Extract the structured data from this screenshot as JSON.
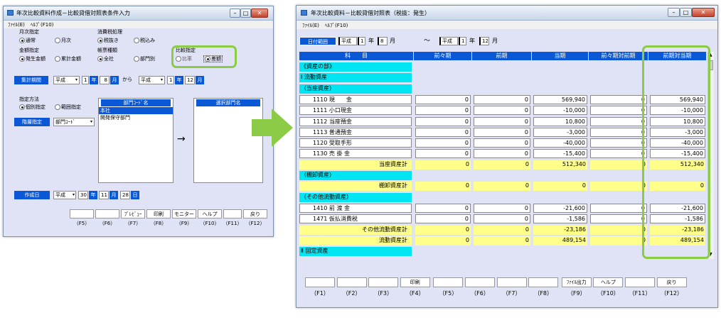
{
  "colors": {
    "accent_blue": "#0a58d6",
    "highlight_cyan": "#00e5f2",
    "subtotal_yellow": "#ffff8a",
    "callout_green": "#8ccb45",
    "panel_bg": "#dfe3f5"
  },
  "left": {
    "title": "年次比較資料作成－比較貸借対照表条件入力",
    "menu": [
      "ﾌｧｲﾙ(E)",
      "ﾍﾙﾌﾟ(F10)"
    ],
    "monthly": {
      "label": "月次指定",
      "options": [
        "通常",
        "月次"
      ]
    },
    "tax": {
      "label": "消費税処理",
      "options": [
        "税抜き",
        "税込み"
      ]
    },
    "amount": {
      "label": "金額指定",
      "options": [
        "発生金額",
        "累計金額"
      ]
    },
    "form": {
      "label": "帳票種類",
      "options": [
        "全社",
        "部門別"
      ]
    },
    "compare": {
      "label": "比較指定",
      "options": [
        "比率",
        "差額"
      ]
    },
    "period": {
      "label": "集計期間",
      "era_from": "平成",
      "year_from": "1",
      "unit_year": "年",
      "month_from": "8",
      "unit_month": "月",
      "kara": "から",
      "era_to": "平成",
      "year_to": "1",
      "month_to": "12"
    },
    "method": {
      "label": "指定方法",
      "options": [
        "個別指定",
        "範囲指定"
      ]
    },
    "hierarchy": {
      "label": "階層指定",
      "value": "部門ｺｰﾄﾞ"
    },
    "dept_list": {
      "header": "部門ｺｰﾄﾞ名",
      "items": [
        "本社",
        "開発保守部門"
      ]
    },
    "arrow": "→",
    "selected_list": {
      "header": "選択部門名"
    },
    "created": {
      "label": "作成日",
      "era": "平成",
      "year": "30",
      "unit_year": "年",
      "month": "11",
      "unit_month": "月",
      "day": "28",
      "unit_day": "日"
    },
    "fbuttons": [
      "",
      "",
      "ﾌﾟﾚﾋﾞｭｰ",
      "印刷",
      "モニター",
      "ヘルプ",
      "",
      "戻り"
    ],
    "fkeys": [
      "（F5）",
      "（F6）",
      "（F7）",
      "（F8）",
      "（F9）",
      "（F10）",
      "（F11）",
      "（F12）"
    ]
  },
  "right": {
    "title": "年次比較資料－比較貸借対照表（税抜：発生）",
    "menu": [
      "ﾌｧｲﾙ(E)",
      "ﾍﾙﾌﾟ(F10)"
    ],
    "range": {
      "label": "日付範囲",
      "era_from": "平成",
      "year_from": "1",
      "unit_year": "年",
      "month_from": "8",
      "unit_month": "月",
      "tilde": "～",
      "era_to": "平成",
      "year_to": "1",
      "month_to": "12"
    },
    "headers": [
      "科　　目",
      "前々期",
      "前期",
      "当期",
      "前々期対前期",
      "前期対当期"
    ],
    "rows": [
      {
        "t": "sec",
        "name": "《資産の部》",
        "v": [
          "",
          "",
          "",
          "",
          ""
        ]
      },
      {
        "t": "sec",
        "name": "Ⅰ 流動資産",
        "v": [
          "",
          "",
          "",
          "",
          ""
        ]
      },
      {
        "t": "sec",
        "name": "（当座資産）",
        "v": [
          "",
          "",
          "",
          "",
          ""
        ]
      },
      {
        "t": "item",
        "name": "1110 現　　金",
        "v": [
          "0",
          "0",
          "569,940",
          "0",
          "569,940"
        ]
      },
      {
        "t": "item",
        "name": "1111 小口現金",
        "v": [
          "0",
          "0",
          "-10,000",
          "0",
          "-10,000"
        ]
      },
      {
        "t": "item",
        "name": "1112 当座預金",
        "v": [
          "0",
          "0",
          "10,800",
          "0",
          "10,800"
        ]
      },
      {
        "t": "item",
        "name": "1113 普通預金",
        "v": [
          "0",
          "0",
          "-3,000",
          "0",
          "-3,000"
        ]
      },
      {
        "t": "item",
        "name": "1120 受取手形",
        "v": [
          "0",
          "0",
          "-40,000",
          "0",
          "-40,000"
        ]
      },
      {
        "t": "item",
        "name": "1130 売 掛 金",
        "v": [
          "0",
          "0",
          "-15,400",
          "0",
          "-15,400"
        ]
      },
      {
        "t": "sub",
        "name": "当座資産計",
        "v": [
          "0",
          "0",
          "512,340",
          "0",
          "512,340"
        ]
      },
      {
        "t": "sec",
        "name": "（棚卸資産）",
        "v": [
          "",
          "",
          "",
          "",
          ""
        ]
      },
      {
        "t": "sub",
        "name": "棚卸資産計",
        "v": [
          "0",
          "0",
          "0",
          "0",
          "0"
        ]
      },
      {
        "t": "sec",
        "name": "（その他流動資産）",
        "v": [
          "",
          "",
          "",
          "",
          ""
        ]
      },
      {
        "t": "item",
        "name": "1410 前 渡 金",
        "v": [
          "0",
          "0",
          "-21,600",
          "0",
          "-21,600"
        ]
      },
      {
        "t": "item",
        "name": "1471 仮払消費税",
        "v": [
          "0",
          "0",
          "-1,586",
          "0",
          "-1,586"
        ]
      },
      {
        "t": "sub",
        "name": "その他流動資産計",
        "v": [
          "0",
          "0",
          "-23,186",
          "0",
          "-23,186"
        ]
      },
      {
        "t": "sub",
        "name": "流動資産計",
        "v": [
          "0",
          "0",
          "489,154",
          "0",
          "489,154"
        ]
      },
      {
        "t": "sec",
        "name": "Ⅱ 固定資産",
        "v": [
          "",
          "",
          "",
          "",
          ""
        ]
      }
    ],
    "fbuttons": [
      "",
      "",
      "",
      "印刷",
      "",
      "",
      "",
      "",
      "ﾌｧｲﾙ出力",
      "ヘルプ",
      "",
      "戻り"
    ],
    "fkeys": [
      "（F1）",
      "（F2）",
      "（F3）",
      "（F4）",
      "（F5）",
      "（F6）",
      "（F7）",
      "（F8）",
      "（F9）",
      "（F10）",
      "（F11）",
      "（F12）"
    ]
  }
}
